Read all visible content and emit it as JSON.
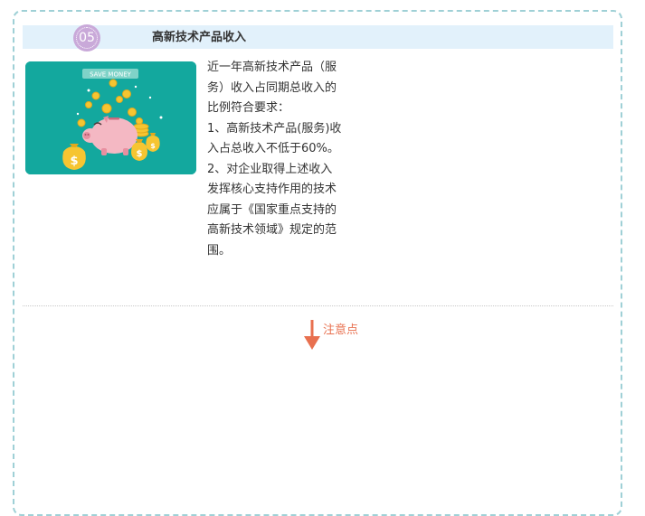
{
  "section": {
    "number": "05",
    "title": "高新技术产品收入"
  },
  "illustration": {
    "banner_text": "SAVE MONEY",
    "coin_symbol": "$",
    "icon": "piggy-bank-icon"
  },
  "content": {
    "paragraphs": [
      "近一年高新技术产品（服务）收入占同期总收入的比例符合要求：",
      "1、高新技术产品(服务)收入占总收入不低于60%。",
      "2、对企业取得上述收入发挥核心支持作用的技术应属于《国家重点支持的高新技术领域》规定的范围。"
    ]
  },
  "note": {
    "label": "注意点",
    "color": "#e8704f"
  },
  "colors": {
    "frame_border": "#9fd0d6",
    "header_bg": "#e2f1fb",
    "badge": "#c9a9d9",
    "illustration_bg": "#13a89e"
  }
}
